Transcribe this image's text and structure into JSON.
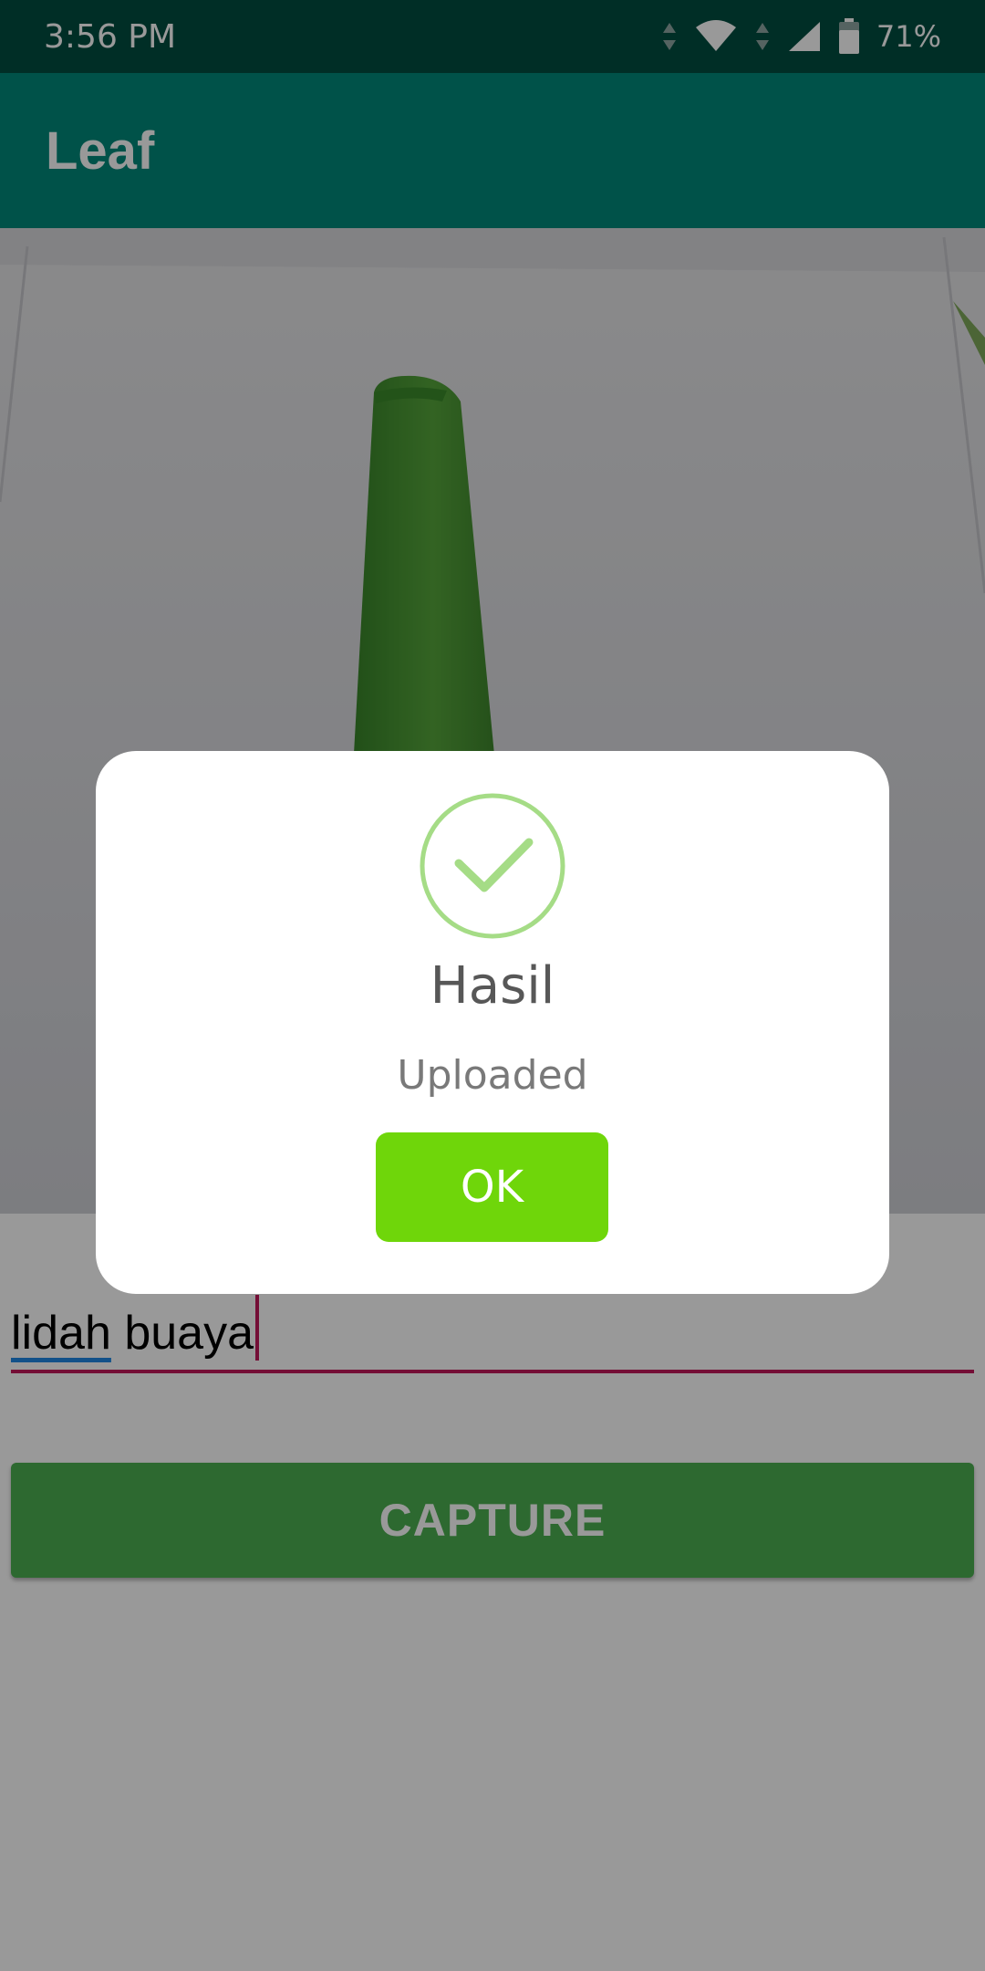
{
  "status_bar": {
    "time": "3:56 PM",
    "battery": "71%",
    "icons": [
      "data-arrows-icon",
      "wifi-icon",
      "signal-icon",
      "battery-icon"
    ]
  },
  "app_bar": {
    "title": "Leaf"
  },
  "photo": {
    "subject": "plant-leaf-image"
  },
  "input": {
    "underlined_word": "lidah",
    "rest": " buaya"
  },
  "capture_button": {
    "label": "CAPTURE"
  },
  "dialog": {
    "icon": "check-circle-icon",
    "title": "Hasil",
    "message": "Uploaded",
    "ok_label": "OK"
  },
  "colors": {
    "status_bar": "#004d40",
    "app_bar": "#00897b",
    "accent": "#c2185b",
    "capture": "#4caf50",
    "ok_button": "#6fd60a",
    "check": "#a5dc86"
  }
}
